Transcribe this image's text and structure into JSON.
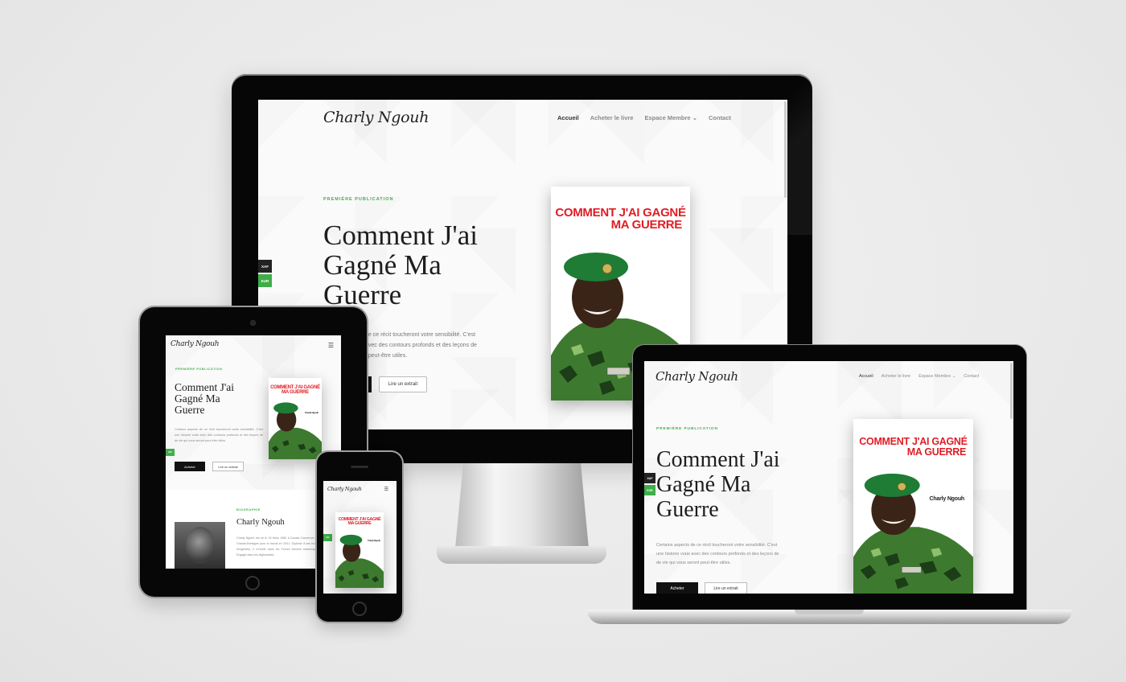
{
  "site": {
    "logo": "Charly Ngouh",
    "nav": {
      "home": "Accueil",
      "buy": "Acheter le livre",
      "members": "Espace Membre",
      "contact": "Contact"
    },
    "eyebrow": "PREMIÈRE PUBLICATION",
    "hero_title_line1": "Comment J'ai",
    "hero_title_line2": "Gagné Ma",
    "hero_title_line3": "Guerre",
    "hero_text_desktop_1": "de ce récit toucheront votre sensibilité. C'est",
    "hero_text_desktop_2": "avec des contours profonds et des leçons de",
    "hero_text_desktop_3": "t peut-être utiles.",
    "hero_text_1": "Certains aspects de ce récit toucheront votre sensibilité. C'est",
    "hero_text_2": "une histoire vraie avec des contours profonds et des leçons de",
    "hero_text_3": "de vie qui vous seront peut-être utiles.",
    "buy_button": "Acheter",
    "excerpt_button": "Lire un extrait",
    "side_tag_1": "XAF",
    "side_tag_2": "EUR",
    "menu_icon": "☰",
    "members_caret": "⌄"
  },
  "book": {
    "title_line1": "COMMENT J'AI GAGNÉ",
    "title_line2": "MA GUERRE",
    "author": "Charly Ngouh",
    "name_tape": "NGOUH"
  },
  "bio": {
    "eyebrow": "BIOGRAPHIE",
    "name": "Charly Ngouh",
    "text": "Charly Ngouh est né le 15 Mars 1980 à Douala Cameroun. Il se rend en Grande-Bretagne pour le travail en 2001. Diplômé d'une école supérieure d'ingénieur, il s'enrôle dans les Forces Armées britanniques en 2006. Engagé dans les Afghanistan."
  },
  "icons": {
    "menu": "hamburger-menu-icon",
    "home_button": "home-button-icon",
    "camera": "camera-icon"
  },
  "colors": {
    "accent": "#3fae49",
    "book_red": "#e01d25",
    "background": "#e9e9e9"
  }
}
